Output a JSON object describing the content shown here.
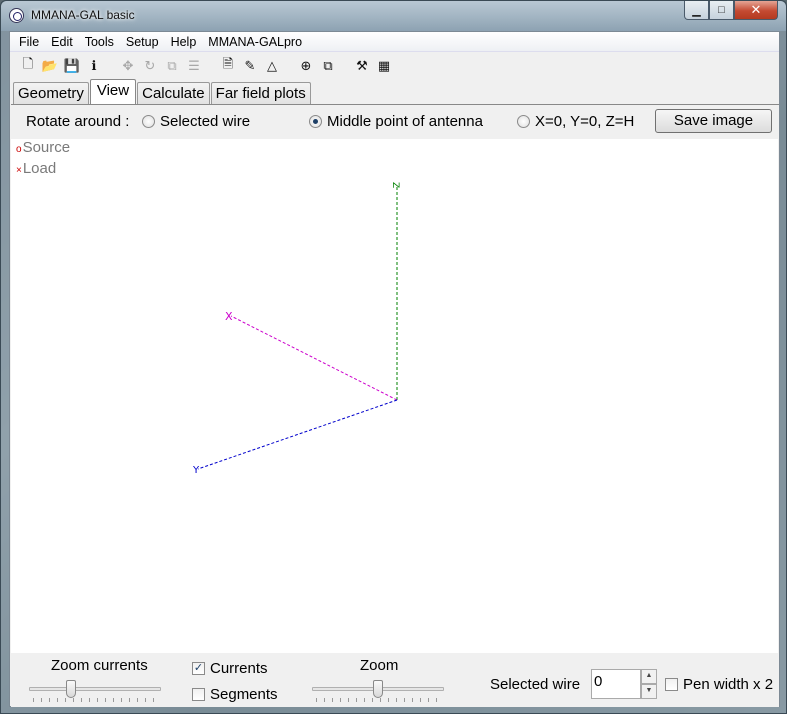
{
  "window": {
    "title": "MMANA-GAL basic"
  },
  "menu": {
    "items": [
      "File",
      "Edit",
      "Tools",
      "Setup",
      "Help",
      "MMANA-GALpro"
    ]
  },
  "toolbar": {
    "icons": [
      "new-file-icon",
      "open-folder-icon",
      "save-icon",
      "info-icon",
      "move-icon",
      "rotate-icon",
      "scale-icon",
      "stretch-icon",
      "document-icon",
      "edit-icon",
      "triangle-icon",
      "crosshair-icon",
      "copy-icon",
      "tools-icon",
      "calculator-icon"
    ]
  },
  "tabs": {
    "geometry": "Geometry",
    "view": "View",
    "calculate": "Calculate",
    "far_field": "Far field plots"
  },
  "rotate": {
    "label": "Rotate around :",
    "options": [
      "Selected wire",
      "Middle point of antenna",
      "X=0, Y=0, Z=H"
    ],
    "selected": "Middle point of antenna"
  },
  "save_image_label": "Save image",
  "legend": {
    "source": "Source",
    "load": "Load"
  },
  "axes": {
    "x": "X",
    "y": "Y",
    "z": "Z"
  },
  "colors": {
    "x_axis": "#cc00cc",
    "y_axis": "#0000cc",
    "z_axis": "#008000"
  },
  "bottom": {
    "zoom_currents_label": "Zoom currents",
    "currents_label": "Currents",
    "currents_checked": true,
    "segments_label": "Segments",
    "segments_checked": false,
    "zoom_label": "Zoom",
    "selected_wire_label": "Selected wire",
    "selected_wire_value": "0",
    "pen_width_label": "Pen width x 2",
    "pen_width_checked": false
  }
}
